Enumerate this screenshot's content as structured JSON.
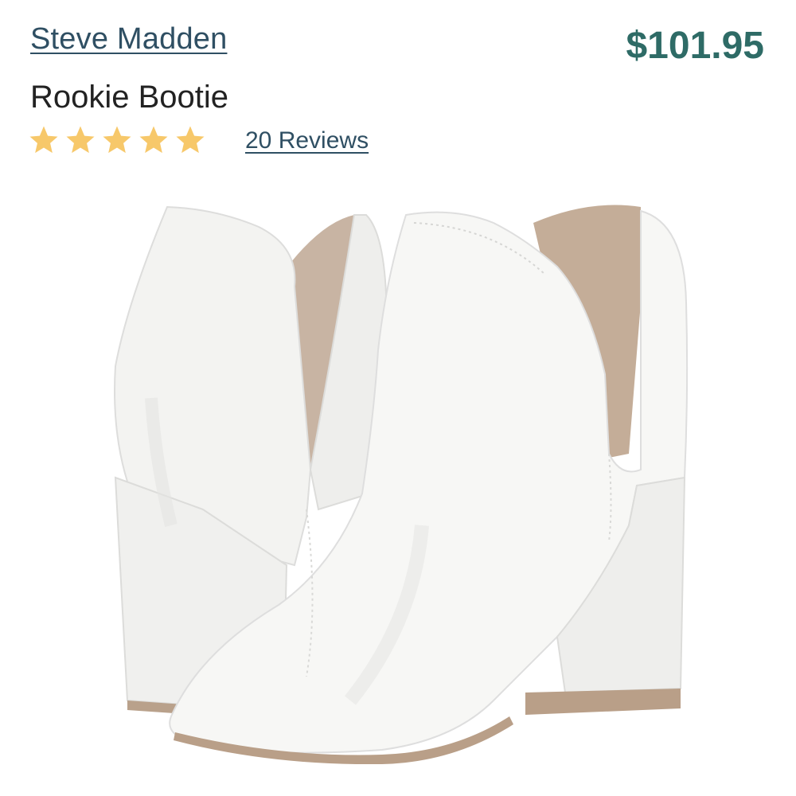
{
  "product": {
    "brand": "Steve Madden",
    "price": "$101.95",
    "name": "Rookie Bootie",
    "rating": 5,
    "rating_max": 5,
    "reviews_label": "20 Reviews",
    "image_alt": "White leather ankle booties with block heels"
  },
  "colors": {
    "brand_link": "#2f4f63",
    "price": "#2e6b66",
    "star": "#f7c86a"
  },
  "icons": {
    "star": "star-icon"
  }
}
